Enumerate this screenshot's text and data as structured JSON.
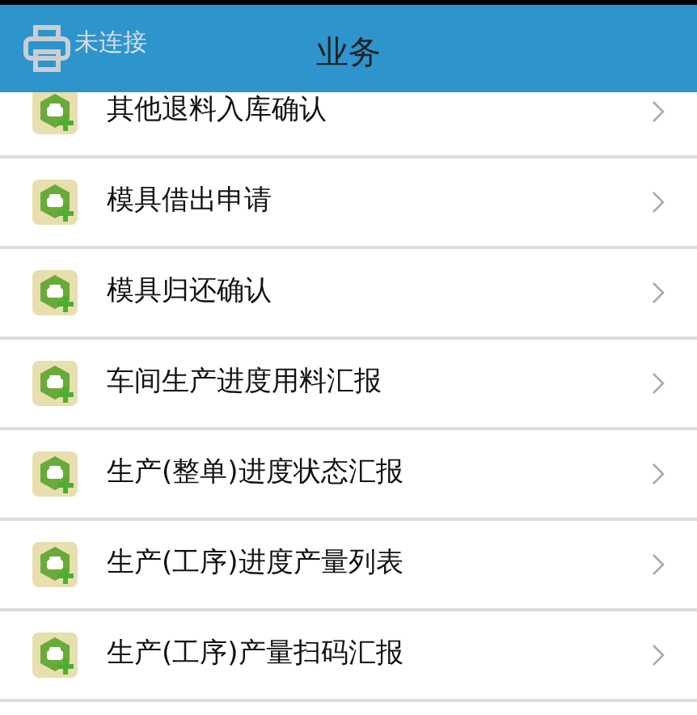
{
  "header": {
    "printer_status": "未连接",
    "title": "业务"
  },
  "items": [
    {
      "label": "其他退料入库确认"
    },
    {
      "label": "模具借出申请"
    },
    {
      "label": "模具归还确认"
    },
    {
      "label": "车间生产进度用料汇报"
    },
    {
      "label": "生产(整单)进度状态汇报"
    },
    {
      "label": "生产(工序)进度产量列表"
    },
    {
      "label": "生产(工序)产量扫码汇报"
    }
  ]
}
